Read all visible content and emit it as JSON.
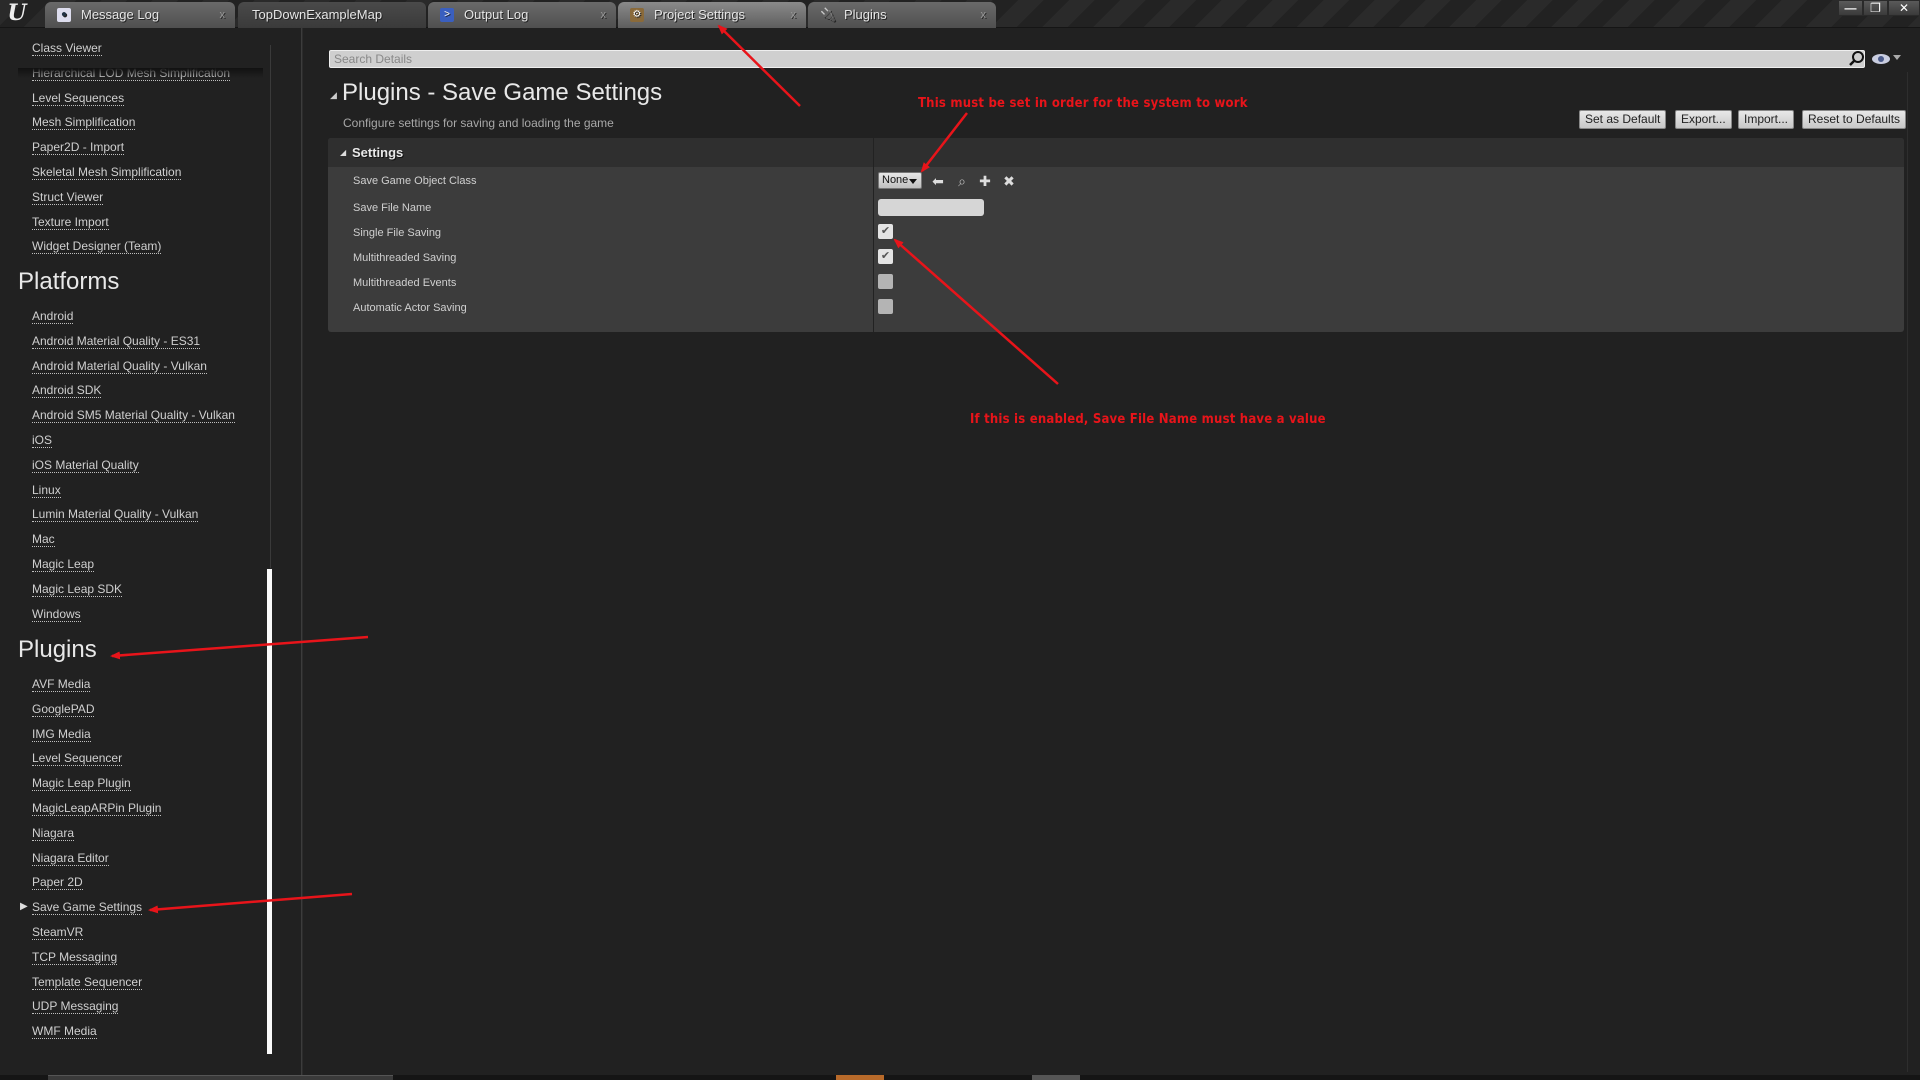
{
  "app": {
    "logo": "U"
  },
  "tabs": [
    {
      "label": "Message Log",
      "icon": "message-log-icon",
      "closable": true
    },
    {
      "label": "TopDownExampleMap",
      "icon": null,
      "closable": false
    },
    {
      "label": "Output Log",
      "icon": "output-log-icon",
      "closable": true
    },
    {
      "label": "Project Settings",
      "icon": "project-settings-icon",
      "closable": true,
      "active": true
    },
    {
      "label": "Plugins",
      "icon": "plugins-icon",
      "closable": true
    }
  ],
  "tab_close_glyph": "x",
  "window_buttons": {
    "minimize": "—",
    "restore": "❐",
    "close": "✕"
  },
  "sidebar": {
    "editor_items_partial": [
      "Class Viewer",
      "Hierarchical LOD Mesh Simplification",
      "Level Sequences",
      "Mesh Simplification",
      "Paper2D - Import",
      "Skeletal Mesh Simplification",
      "Struct Viewer",
      "Texture Import",
      "Widget Designer (Team)"
    ],
    "platforms_heading": "Platforms",
    "platforms": [
      "Android",
      "Android Material Quality - ES31",
      "Android Material Quality - Vulkan",
      "Android SDK",
      "Android SM5 Material Quality - Vulkan",
      "iOS",
      "iOS Material Quality",
      "Linux",
      "Lumin Material Quality - Vulkan",
      "Mac",
      "Magic Leap",
      "Magic Leap SDK",
      "Windows"
    ],
    "plugins_heading": "Plugins",
    "plugins": [
      "AVF Media",
      "GooglePAD",
      "IMG Media",
      "Level Sequencer",
      "Magic Leap Plugin",
      "MagicLeapARPin Plugin",
      "Niagara",
      "Niagara Editor",
      "Paper 2D",
      "Save Game Settings",
      "SteamVR",
      "TCP Messaging",
      "Template Sequencer",
      "UDP Messaging",
      "WMF Media"
    ],
    "selected_plugin": "Save Game Settings"
  },
  "details": {
    "search_placeholder": "Search Details",
    "title": "Plugins - Save Game Settings",
    "description": "Configure settings for saving and loading the game",
    "buttons": {
      "set_as_default": "Set as Default",
      "export": "Export...",
      "import": "Import...",
      "reset": "Reset to Defaults"
    },
    "section_label": "Settings",
    "properties": {
      "save_game_object_class": {
        "label": "Save Game Object Class",
        "value": "None"
      },
      "save_file_name": {
        "label": "Save File Name",
        "value": ""
      },
      "single_file_saving": {
        "label": "Single File Saving",
        "checked": true
      },
      "multithreaded_saving": {
        "label": "Multithreaded Saving",
        "checked": true
      },
      "multithreaded_events": {
        "label": "Multithreaded Events",
        "checked": false
      },
      "automatic_actor_saving": {
        "label": "Automatic Actor Saving",
        "checked": false
      }
    },
    "tool_icons": {
      "use": "⬅",
      "browse": "⌕",
      "add": "✚",
      "clear": "✖"
    },
    "check_glyph": "✔"
  },
  "annotations": {
    "note_object_class": "This must be set in order for the system to work",
    "note_single_file": "If this is enabled, Save File Name must have a value",
    "color": "#e8141a"
  },
  "colors": {
    "background": "#212121",
    "panel": "#3c3c3c",
    "accent_orange": "#b86a2a"
  }
}
